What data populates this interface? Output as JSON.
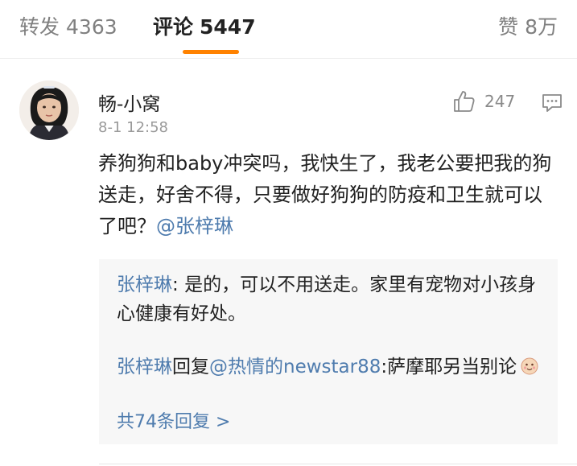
{
  "tabs": {
    "repost": {
      "label": "转发",
      "count": "4363"
    },
    "comments": {
      "label": "评论",
      "count": "5447"
    },
    "likes": {
      "label": "赞",
      "count": "8万"
    },
    "active": "comments",
    "accent_color": "#ff8200"
  },
  "comment": {
    "username": "畅-小窝",
    "timestamp": "8-1 12:58",
    "like_count": "247",
    "text": "养狗狗和baby冲突吗，我快生了，我老公要把我的狗送走，好舍不得，只要做好狗狗的防疫和卫生就可以了吧？",
    "mention": "@张梓琳"
  },
  "replies": [
    {
      "author": "张梓琳",
      "separator": ": ",
      "text": "是的，可以不用送走。家里有宠物对小孩身心健康有好处。"
    },
    {
      "author": "张梓琳",
      "verb": "回复",
      "target": "@热情的newstar88",
      "separator": ":",
      "text": "萨摩耶另当别论",
      "emoji": "smiling-face-emoji"
    }
  ],
  "more_replies": "共74条回复 >",
  "colors": {
    "link": "#4f7cae",
    "text": "#222222",
    "muted": "#8a8a8a",
    "reply_bg": "#f7f7f7"
  }
}
